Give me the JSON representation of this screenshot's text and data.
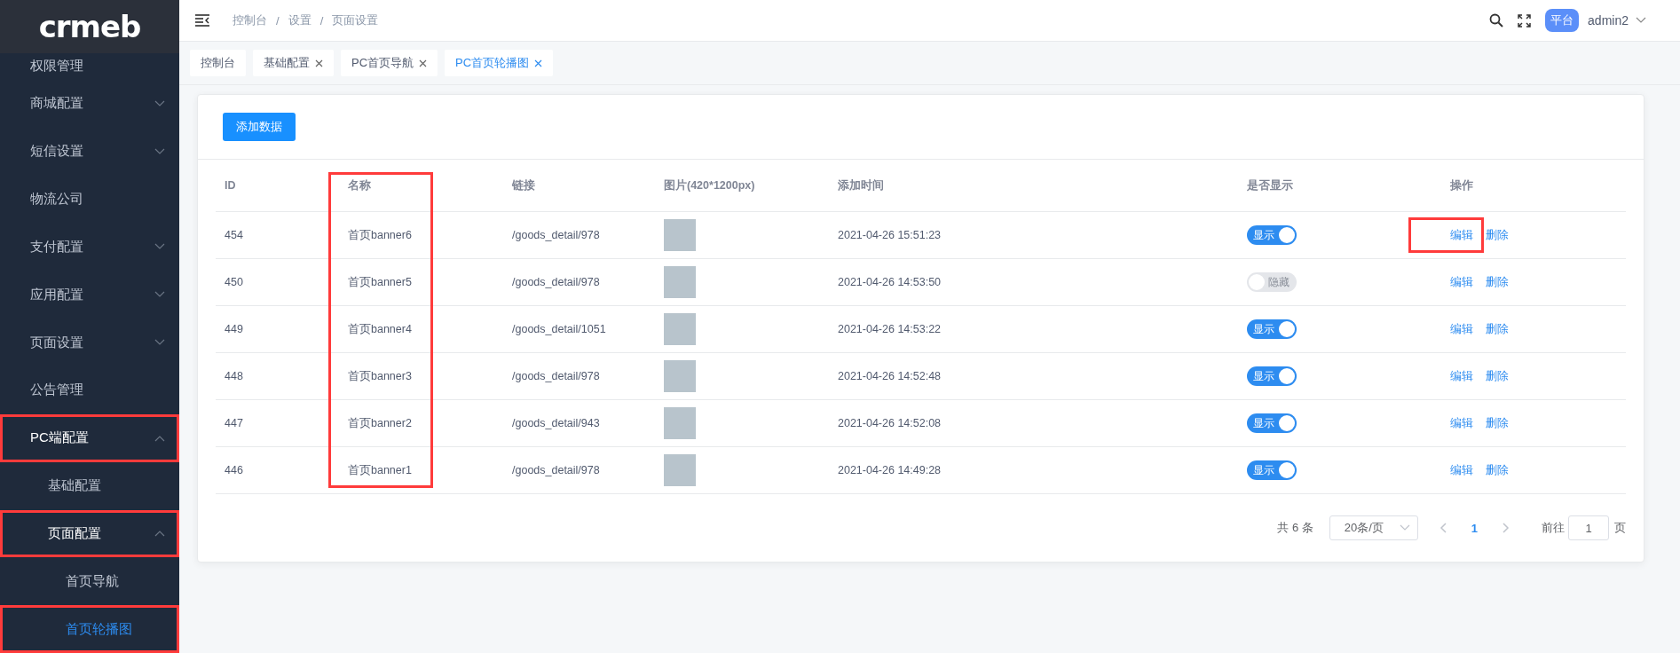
{
  "sidebar": {
    "logo": "crmeb",
    "items": [
      {
        "label": "权限管理",
        "selected": false,
        "highlighted": false
      },
      {
        "label": "商城配置",
        "expanded": false,
        "selected": false,
        "highlighted": false
      },
      {
        "label": "短信设置",
        "expanded": false,
        "selected": false,
        "highlighted": false
      },
      {
        "label": "物流公司",
        "selected": false,
        "highlighted": false
      },
      {
        "label": "支付配置",
        "expanded": false,
        "selected": false,
        "highlighted": false
      },
      {
        "label": "应用配置",
        "expanded": false,
        "selected": false,
        "highlighted": false
      },
      {
        "label": "页面设置",
        "expanded": false,
        "selected": false,
        "highlighted": false
      },
      {
        "label": "公告管理",
        "selected": false,
        "highlighted": false
      },
      {
        "label": "PC端配置",
        "expanded": true,
        "selected": false,
        "highlighted": true,
        "children": [
          {
            "label": "基础配置",
            "selected": false,
            "highlighted": false
          },
          {
            "label": "页面配置",
            "expanded": true,
            "selected": false,
            "highlighted": true,
            "children": [
              {
                "label": "首页导航",
                "selected": false,
                "highlighted": false
              },
              {
                "label": "首页轮播图",
                "selected": true,
                "highlighted": true
              }
            ]
          }
        ]
      }
    ]
  },
  "header": {
    "breadcrumb": [
      "控制台",
      "设置",
      "页面设置"
    ],
    "separator": "/",
    "badge": "平台",
    "user": "admin2"
  },
  "tabs": [
    {
      "label": "控制台",
      "closable": false,
      "selected": false
    },
    {
      "label": "基础配置",
      "closable": true,
      "selected": false
    },
    {
      "label": "PC首页导航",
      "closable": true,
      "selected": false
    },
    {
      "label": "PC首页轮播图",
      "closable": true,
      "selected": true
    }
  ],
  "add_button": "添加数据",
  "table": {
    "columns": [
      {
        "label": "ID",
        "highlighted": false
      },
      {
        "label": "名称",
        "highlighted": true
      },
      {
        "label": "链接",
        "highlighted": false
      },
      {
        "label": "图片(420*1200px)",
        "highlighted": false
      },
      {
        "label": "添加时间",
        "highlighted": false
      },
      {
        "label": "是否显示",
        "highlighted": false
      },
      {
        "label": "操作",
        "highlighted": false
      }
    ],
    "rows": [
      {
        "id": "454",
        "name": "首页banner6",
        "link": "/goods_detail/978",
        "time": "2021-04-26 15:51:23",
        "visible": true,
        "toggle_label": "显示",
        "actions": [
          "编辑",
          "删除"
        ],
        "edit_highlighted": true
      },
      {
        "id": "450",
        "name": "首页banner5",
        "link": "/goods_detail/978",
        "time": "2021-04-26 14:53:50",
        "visible": false,
        "toggle_label": "隐藏",
        "actions": [
          "编辑",
          "删除"
        ],
        "edit_highlighted": false
      },
      {
        "id": "449",
        "name": "首页banner4",
        "link": "/goods_detail/1051",
        "time": "2021-04-26 14:53:22",
        "visible": true,
        "toggle_label": "显示",
        "actions": [
          "编辑",
          "删除"
        ],
        "edit_highlighted": false
      },
      {
        "id": "448",
        "name": "首页banner3",
        "link": "/goods_detail/978",
        "time": "2021-04-26 14:52:48",
        "visible": true,
        "toggle_label": "显示",
        "actions": [
          "编辑",
          "删除"
        ],
        "edit_highlighted": false
      },
      {
        "id": "447",
        "name": "首页banner2",
        "link": "/goods_detail/943",
        "time": "2021-04-26 14:52:08",
        "visible": true,
        "toggle_label": "显示",
        "actions": [
          "编辑",
          "删除"
        ],
        "edit_highlighted": false
      },
      {
        "id": "446",
        "name": "首页banner1",
        "link": "/goods_detail/978",
        "time": "2021-04-26 14:49:28",
        "visible": true,
        "toggle_label": "显示",
        "actions": [
          "编辑",
          "删除"
        ],
        "edit_highlighted": false
      }
    ]
  },
  "pagination": {
    "total": "共 6 条",
    "page_size": "20条/页",
    "pages": [
      {
        "label": "1",
        "selected": true
      }
    ],
    "goto_label": "前往",
    "goto_value": "1",
    "goto_suffix": "页"
  }
}
